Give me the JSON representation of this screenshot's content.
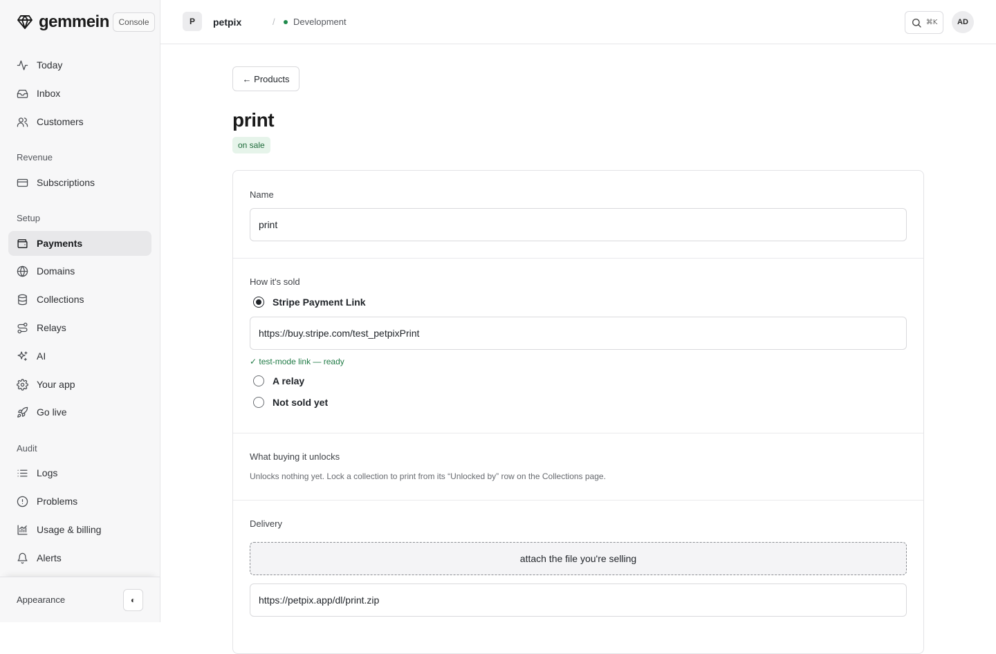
{
  "brand": {
    "name": "gemmein",
    "console_label": "Console"
  },
  "sidebar": {
    "primary": [
      {
        "label": "Today",
        "icon": "activity-icon"
      },
      {
        "label": "Inbox",
        "icon": "inbox-icon"
      },
      {
        "label": "Customers",
        "icon": "users-icon"
      }
    ],
    "sections": [
      {
        "title": "Revenue",
        "items": [
          {
            "label": "Subscriptions",
            "icon": "credit-card-icon"
          }
        ]
      },
      {
        "title": "Setup",
        "items": [
          {
            "label": "Payments",
            "icon": "wallet-icon",
            "active": true
          },
          {
            "label": "Domains",
            "icon": "globe-icon"
          },
          {
            "label": "Collections",
            "icon": "database-icon"
          },
          {
            "label": "Relays",
            "icon": "route-icon"
          },
          {
            "label": "AI",
            "icon": "sparkles-icon"
          },
          {
            "label": "Your app",
            "icon": "gear-icon"
          },
          {
            "label": "Go live",
            "icon": "rocket-icon"
          }
        ]
      },
      {
        "title": "Audit",
        "items": [
          {
            "label": "Logs",
            "icon": "list-icon"
          },
          {
            "label": "Problems",
            "icon": "alert-circle-icon"
          },
          {
            "label": "Usage & billing",
            "icon": "chart-icon"
          },
          {
            "label": "Alerts",
            "icon": "bell-icon"
          }
        ]
      }
    ],
    "footer": {
      "appearance_label": "Appearance",
      "toggle_glyph": "◐"
    }
  },
  "topbar": {
    "project_initial": "P",
    "project_name": "petpix",
    "separator": "/",
    "environment": "Development",
    "search_shortcut": "⌘K",
    "user_initials": "AD"
  },
  "main": {
    "back_label": "← Products",
    "title": "print",
    "status": "on sale",
    "colors": {
      "status_bg": "#e6f4ea",
      "status_text": "#1e6b3a",
      "env_dot": "#1f8a4c"
    },
    "name_section": {
      "label": "Name",
      "value": "print"
    },
    "sold_section": {
      "label": "How it's sold",
      "options": [
        {
          "label": "Stripe Payment Link",
          "selected": true
        },
        {
          "label": "A relay",
          "selected": false
        },
        {
          "label": "Not sold yet",
          "selected": false
        }
      ],
      "stripe_link": "https://buy.stripe.com/test_petpixPrint",
      "link_status": "✓ test-mode link — ready"
    },
    "unlocks_section": {
      "label": "What buying it unlocks",
      "text": "Unlocks nothing yet. Lock a collection to print from its “Unlocked by” row on the Collections page."
    },
    "delivery_section": {
      "label": "Delivery",
      "attach_label": "attach the file you're selling",
      "download_url": "https://petpix.app/dl/print.zip"
    }
  }
}
